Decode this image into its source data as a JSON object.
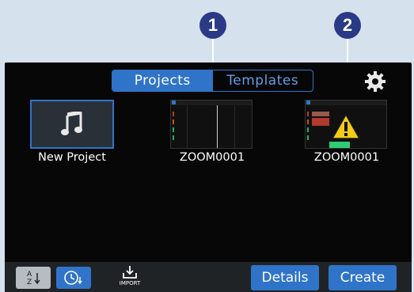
{
  "callouts": [
    "1",
    "2"
  ],
  "tabs": {
    "projects": "Projects",
    "templates": "Templates"
  },
  "tiles": {
    "new_project": "New Project",
    "project_1": "ZOOM0001",
    "project_2": "ZOOM0001"
  },
  "bottom_bar": {
    "sort_alpha_icon": "A-Z sort icon",
    "sort_time_icon": "clock sort icon",
    "import_label": "IMPORT",
    "details": "Details",
    "create": "Create"
  },
  "colors": {
    "accent": "#2f74c8",
    "callout": "#2b3a86",
    "warning": "#f3cc15",
    "screen_bg": "#070707"
  }
}
